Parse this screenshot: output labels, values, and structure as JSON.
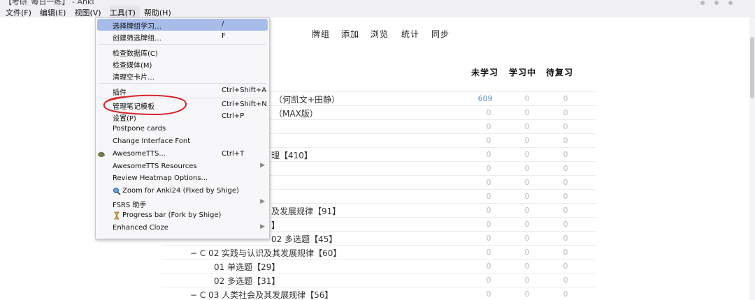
{
  "window": {
    "title": "【考研_每日一练】 - Anki"
  },
  "menubar": {
    "items": [
      {
        "label": "文件(F)"
      },
      {
        "label": "编辑(E)"
      },
      {
        "label": "视图(V)"
      },
      {
        "label": "工具(T)"
      },
      {
        "label": "帮助(H)"
      }
    ]
  },
  "toolbar": {
    "decks": "牌组",
    "add": "添加",
    "browse": "浏览",
    "stats": "统计",
    "sync": "同步"
  },
  "table": {
    "headers": {
      "new": "未学习",
      "learn": "学习中",
      "due": "待复习"
    },
    "rows": [
      {
        "name": "（何凯文+田静）",
        "new": "609",
        "learn": "0",
        "due": "0"
      },
      {
        "name": "（MAX版）",
        "new": "0",
        "learn": "0",
        "due": "0"
      },
      {
        "name": "",
        "new": "0",
        "learn": "0",
        "due": "0"
      },
      {
        "name": "",
        "new": "0",
        "learn": "0",
        "due": "0"
      },
      {
        "name": "理【410】",
        "new": "0",
        "learn": "0",
        "due": "0"
      },
      {
        "name": "",
        "new": "0",
        "learn": "0",
        "due": "0"
      },
      {
        "name": "",
        "new": "0",
        "learn": "0",
        "due": "0"
      },
      {
        "name": "",
        "new": "0",
        "learn": "0",
        "due": "0"
      },
      {
        "name": "及发展规律【91】",
        "new": "0",
        "learn": "0",
        "due": "0"
      },
      {
        "name": "】",
        "new": "0",
        "learn": "0",
        "due": "0"
      },
      {
        "name": "02 多选题【45】",
        "new": "0",
        "learn": "0",
        "due": "0"
      },
      {
        "name": "− C 02 实践与认识及其发展规律【60】",
        "new": "0",
        "learn": "0",
        "due": "0"
      },
      {
        "name": "01 单选题【29】",
        "new": "0",
        "learn": "0",
        "due": "0"
      },
      {
        "name": "02 多选题【31】",
        "new": "0",
        "learn": "0",
        "due": "0"
      },
      {
        "name": "− C 03 人类社会及其发展规律【56】",
        "new": "0",
        "learn": "0",
        "due": "0"
      }
    ]
  },
  "tools_menu": {
    "items": [
      {
        "label": "选择牌组学习…",
        "shortcut": "/"
      },
      {
        "label": "创建筛选牌组…",
        "shortcut": "F"
      },
      {
        "label": "检查数据库(C)",
        "shortcut": ""
      },
      {
        "label": "检查媒体(M)",
        "shortcut": ""
      },
      {
        "label": "清理空卡片…",
        "shortcut": ""
      },
      {
        "label": "插件",
        "shortcut": "Ctrl+Shift+A"
      },
      {
        "label": "管理笔记模板",
        "shortcut": "Ctrl+Shift+N"
      },
      {
        "label": "设置(P)",
        "shortcut": "Ctrl+P"
      },
      {
        "label": "Postpone cards",
        "shortcut": ""
      },
      {
        "label": "Change Interface Font",
        "shortcut": ""
      },
      {
        "label": "AwesomeTTS...",
        "shortcut": "Ctrl+T"
      },
      {
        "label": "AwesomeTTS Resources",
        "shortcut": ""
      },
      {
        "label": "Review Heatmap Options...",
        "shortcut": ""
      },
      {
        "label": "Zoom for Anki24 (Fixed by Shige)",
        "shortcut": ""
      },
      {
        "label": "FSRS 助手",
        "shortcut": ""
      },
      {
        "label": "Progress bar (Fork by Shige)",
        "shortcut": ""
      },
      {
        "label": "Enhanced Cloze",
        "shortcut": ""
      }
    ]
  },
  "colors": {
    "highlight": "#a7bce8",
    "annotation": "#d9252a",
    "new_count": "#5d8bd9"
  }
}
